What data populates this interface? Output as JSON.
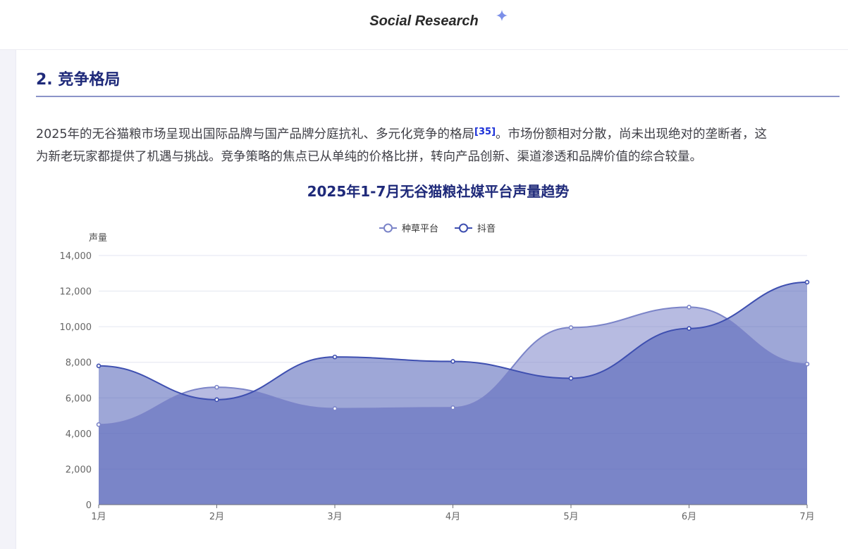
{
  "header": {
    "brand": "Social Research"
  },
  "section": {
    "title": "2. 竞争格局",
    "para_line1_a": "2025年的无谷猫粮市场呈现出国际品牌与国产品牌分庭抗礼、多元化竞争的格局",
    "citation": "[35]",
    "para_line1_b": "。市场份额相对分散，尚未出现绝对的垄断者，这",
    "para_line2": "为新老玩家都提供了机遇与挑战。竞争策略的焦点已从单纯的价格比拼，转向产品创新、渠道渗透和品牌价值的综合较量。"
  },
  "colors": {
    "series1": "#7b84c8",
    "series2": "#3e4fb0",
    "title": "#1f2a7a"
  },
  "chart_data": {
    "type": "area",
    "title": "2025年1-7月无谷猫粮社媒平台声量趋势",
    "ylabel": "声量",
    "xlabel": "",
    "categories": [
      "1月",
      "2月",
      "3月",
      "4月",
      "5月",
      "6月",
      "7月"
    ],
    "ylim": [
      0,
      14000
    ],
    "yticks": [
      "14,000",
      "12,000",
      "10,000",
      "8,000",
      "6,000",
      "4,000",
      "2,000",
      "0"
    ],
    "grid": true,
    "legend": "top-center",
    "series": [
      {
        "name": "种草平台",
        "values": [
          4500,
          6600,
          5400,
          5450,
          9950,
          11100,
          7900
        ]
      },
      {
        "name": "抖音",
        "values": [
          7800,
          5900,
          8300,
          8050,
          7100,
          9900,
          12500
        ]
      }
    ]
  }
}
